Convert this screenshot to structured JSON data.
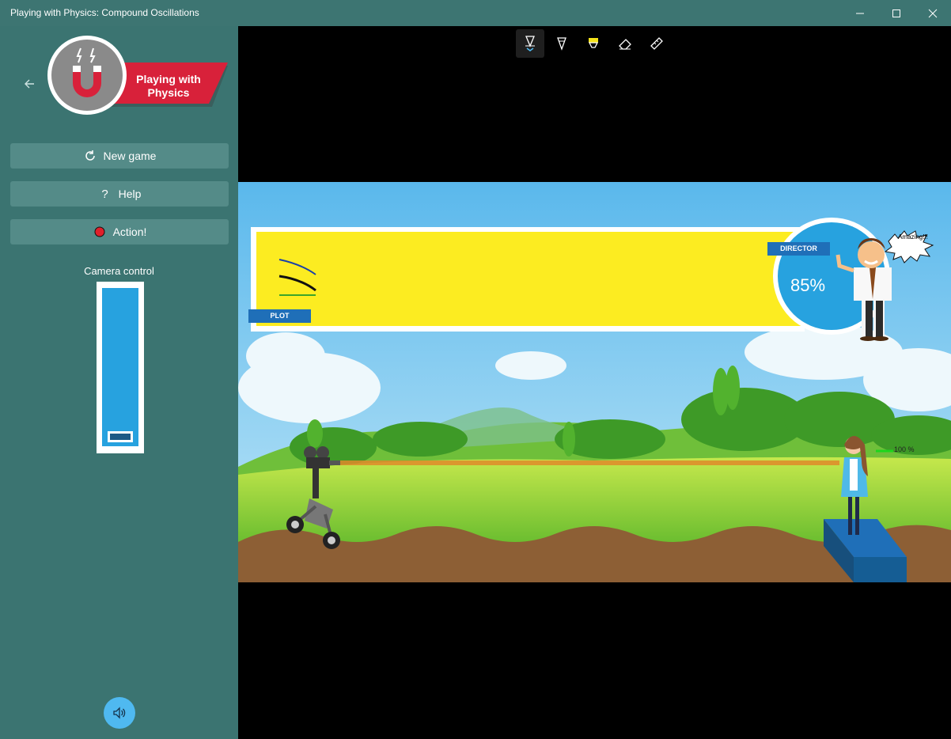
{
  "window": {
    "title": "Playing with Physics: Compound Oscillations"
  },
  "sidebar": {
    "logo_text_line1": "Playing with",
    "logo_text_line2": "Physics",
    "buttons": [
      {
        "label": "New game",
        "icon": "refresh-icon"
      },
      {
        "label": "Help",
        "icon": "question-icon"
      },
      {
        "label": "Action!",
        "icon": "record-icon"
      }
    ],
    "camera_label": "Camera control",
    "camera_level": 0.0
  },
  "ink_toolbar": {
    "tools": [
      "ballpoint-pen-icon",
      "pencil-icon",
      "highlighter-icon",
      "eraser-icon",
      "ruler-icon"
    ],
    "active": 0
  },
  "game": {
    "plot_label": "PLOT",
    "director_label": "DIRECTOR",
    "score": "85%",
    "speech": "Amazing!!!",
    "actor_percent": "100 %"
  },
  "colors": {
    "sidebar": "#3b7471",
    "titlebar": "#3d7572",
    "button": "#548b88",
    "accent": "#27a2df",
    "plot_bg": "#fcec21",
    "record": "#e0202a"
  }
}
